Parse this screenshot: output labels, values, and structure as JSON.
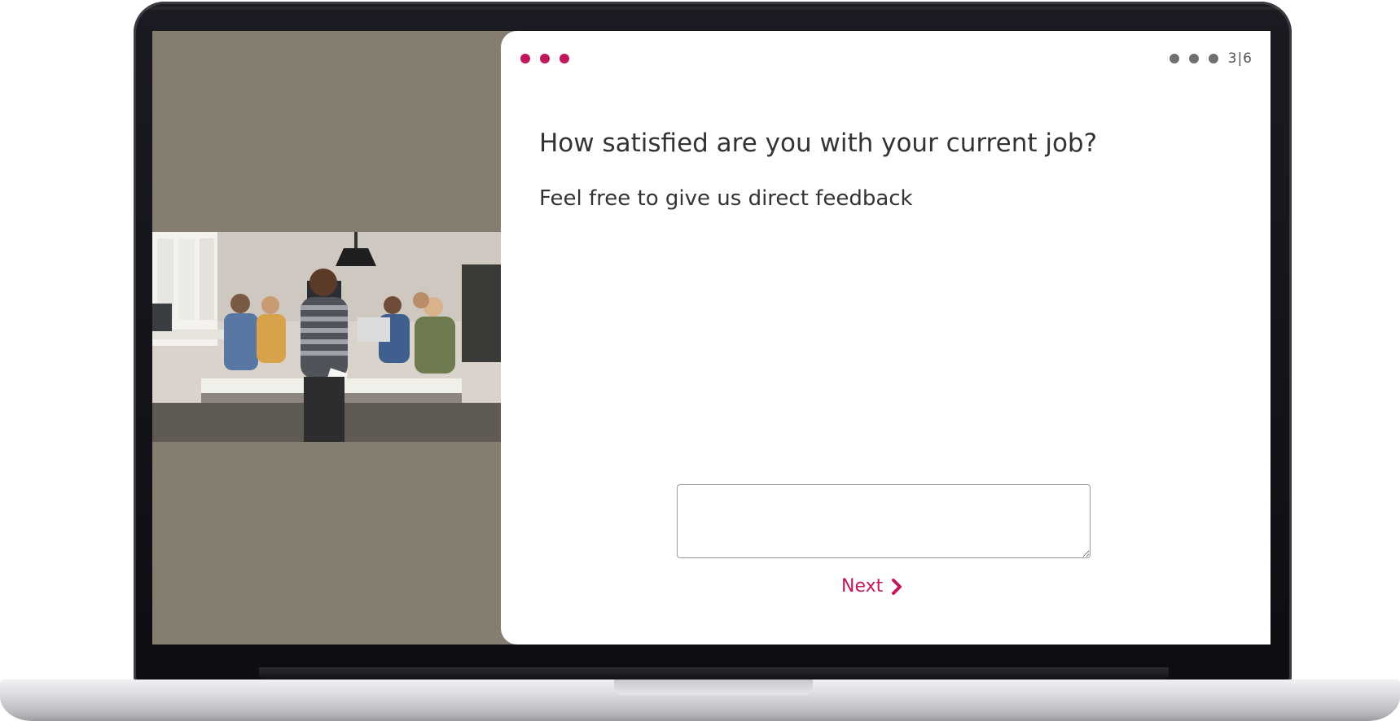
{
  "theme": {
    "accent": "#c2185b",
    "panel_bg": "#ffffff",
    "backdrop": "#857e70",
    "progress_dot": "#707070"
  },
  "header": {
    "menu_icon": "more-dots-icon",
    "progress_label": "3|6"
  },
  "question": {
    "title": "How satisfied  are you with your current  job?",
    "subtitle": "Feel free to give us direct feedback"
  },
  "answer": {
    "value": "",
    "placeholder": ""
  },
  "navigation": {
    "next_label": "Next",
    "next_icon": "chevron-right-icon"
  },
  "media": {
    "photo_icon": "team-photo"
  }
}
